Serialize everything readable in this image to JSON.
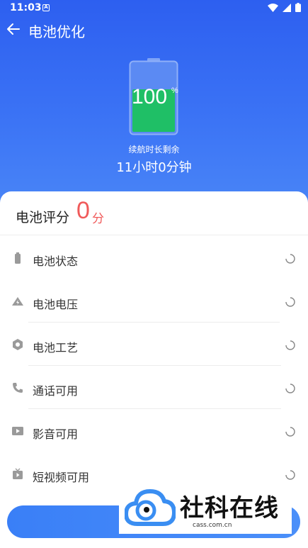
{
  "status_bar": {
    "time": "11:03",
    "notif_letter": "A"
  },
  "app_bar": {
    "title": "电池优化"
  },
  "battery": {
    "level_value": "100",
    "level_unit": "%",
    "fill_fraction": 1.0,
    "fill_color": "#1fbf66"
  },
  "remaining": {
    "label": "续航时长剩余",
    "value": "11小时0分钟"
  },
  "score": {
    "label": "电池评分",
    "value": "0",
    "unit": "分"
  },
  "items": [
    {
      "label": "电池状态",
      "icon": "battery-icon"
    },
    {
      "label": "电池电压",
      "icon": "voltage-icon"
    },
    {
      "label": "电池工艺",
      "icon": "hexagon-icon"
    },
    {
      "label": "通话可用",
      "icon": "phone-icon"
    },
    {
      "label": "影音可用",
      "icon": "play-icon"
    },
    {
      "label": "短视频可用",
      "icon": "video-icon"
    }
  ],
  "watermark": {
    "text": "社科在线",
    "sub": "cass.com.cn"
  },
  "colors": {
    "primary": "#2f63f0",
    "score_red": "#f05a5a"
  }
}
